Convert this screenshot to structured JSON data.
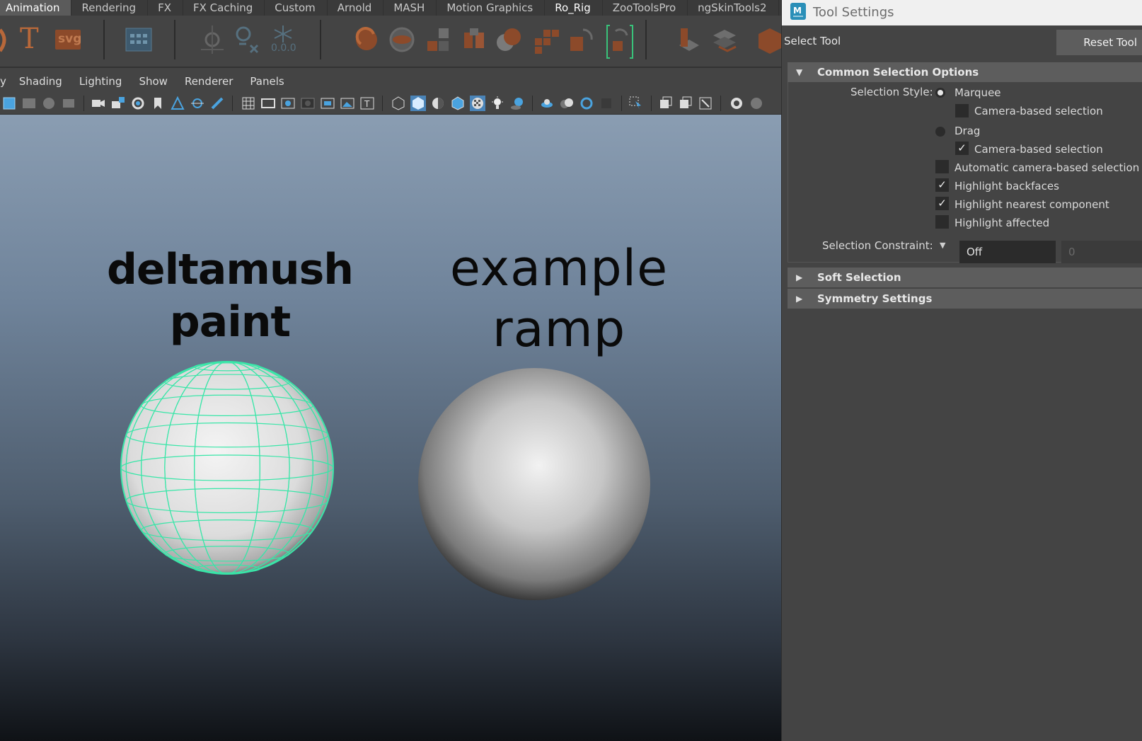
{
  "shelf": {
    "tabs": [
      "Animation",
      "Rendering",
      "FX",
      "FX Caching",
      "Custom",
      "Arnold",
      "MASH",
      "Motion Graphics",
      "Ro_Rig",
      "ZooToolsPro",
      "ngSkinTools2"
    ],
    "active_tab": "Animation",
    "svg_icon_text": "svg",
    "text_icon_glyph": "T",
    "snowflake_value": "0.0.0"
  },
  "panel_menu": {
    "items": [
      "Shading",
      "Lighting",
      "Show",
      "Renderer",
      "Panels"
    ]
  },
  "viewport": {
    "left_label_line1": "deltamush",
    "left_label_line2": "paint",
    "right_label_line1": "example",
    "right_label_line2": "ramp",
    "wireframe_color": "#39e6a8"
  },
  "tool_settings": {
    "window_title": "Tool Settings",
    "logo_letter": "M",
    "tool_name": "Select Tool",
    "reset_label": "Reset Tool",
    "common_section": {
      "title": "Common Selection Options",
      "selection_style_label": "Selection Style:",
      "marquee_label": "Marquee",
      "marquee_camera_label": "Camera-based selection",
      "marquee_camera_checked": false,
      "drag_label": "Drag",
      "drag_camera_label": "Camera-based selection",
      "drag_camera_checked": true,
      "auto_camera_label": "Automatic camera-based selection",
      "auto_camera_checked": false,
      "highlight_backfaces_label": "Highlight backfaces",
      "highlight_backfaces_checked": true,
      "highlight_nearest_label": "Highlight nearest component",
      "highlight_nearest_checked": true,
      "highlight_affected_label": "Highlight affected",
      "highlight_affected_checked": false,
      "constraint_label": "Selection Constraint:",
      "constraint_value": "Off",
      "constraint_number": "0"
    },
    "soft_selection_title": "Soft Selection",
    "symmetry_title": "Symmetry Settings",
    "check_glyph": "✓"
  }
}
